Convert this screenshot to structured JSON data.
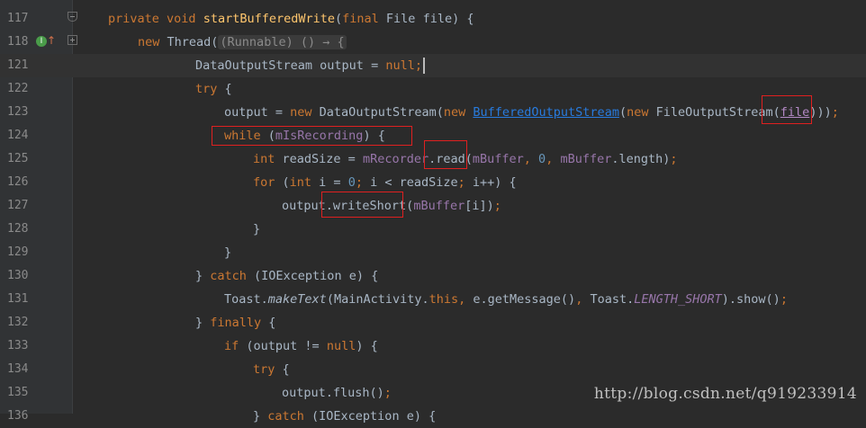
{
  "editor": {
    "current_line": 121,
    "lines": [
      {
        "number": "117",
        "tokens": [
          {
            "t": "private",
            "c": "kw"
          },
          {
            "t": " "
          },
          {
            "t": "void",
            "c": "kw"
          },
          {
            "t": " "
          },
          {
            "t": "startBufferedWrite",
            "c": "fn"
          },
          {
            "t": "("
          },
          {
            "t": "final",
            "c": "kw"
          },
          {
            "t": " File file) {"
          }
        ]
      },
      {
        "number": "118",
        "tokens": [
          {
            "t": "new",
            "c": "kw"
          },
          {
            "t": " Thread("
          },
          {
            "t": "(Runnable) () → {",
            "c": "hint"
          }
        ]
      },
      {
        "number": "121",
        "tokens": [
          {
            "t": "DataOutputStream output = "
          },
          {
            "t": "null",
            "c": "kw"
          },
          {
            "t": ";",
            "c": "kw"
          }
        ]
      },
      {
        "number": "122",
        "tokens": [
          {
            "t": "try",
            "c": "kw"
          },
          {
            "t": " {"
          }
        ]
      },
      {
        "number": "123",
        "tokens": [
          {
            "t": "output = "
          },
          {
            "t": "new",
            "c": "kw"
          },
          {
            "t": " DataOutputStream("
          },
          {
            "t": "new",
            "c": "kw"
          },
          {
            "t": " "
          },
          {
            "t": "BufferedOutputStream",
            "c": "link"
          },
          {
            "t": "("
          },
          {
            "t": "new",
            "c": "kw"
          },
          {
            "t": " FileOutputStream("
          },
          {
            "t": "file",
            "c": "paramu"
          },
          {
            "t": ")))"
          },
          {
            "t": ";",
            "c": "kw"
          }
        ]
      },
      {
        "number": "124",
        "tokens": [
          {
            "t": "while",
            "c": "kw"
          },
          {
            "t": " ("
          },
          {
            "t": "mIsRecording",
            "c": "fld"
          },
          {
            "t": ") {"
          }
        ]
      },
      {
        "number": "125",
        "tokens": [
          {
            "t": "int",
            "c": "kw"
          },
          {
            "t": " readSize = "
          },
          {
            "t": "mRecorder",
            "c": "fld"
          },
          {
            "t": ".read("
          },
          {
            "t": "mBuffer",
            "c": "fld"
          },
          {
            "t": ", ",
            "c": "kw"
          },
          {
            "t": "0",
            "c": "num"
          },
          {
            "t": ", ",
            "c": "kw"
          },
          {
            "t": "mBuffer",
            "c": "fld"
          },
          {
            "t": ".length)"
          },
          {
            "t": ";",
            "c": "kw"
          }
        ]
      },
      {
        "number": "126",
        "tokens": [
          {
            "t": "for",
            "c": "kw"
          },
          {
            "t": " ("
          },
          {
            "t": "int",
            "c": "kw"
          },
          {
            "t": " i = "
          },
          {
            "t": "0",
            "c": "num"
          },
          {
            "t": "; ",
            "c": "kw"
          },
          {
            "t": "i < readSize"
          },
          {
            "t": "; ",
            "c": "kw"
          },
          {
            "t": "i++) {"
          }
        ]
      },
      {
        "number": "127",
        "tokens": [
          {
            "t": "output.writeShort("
          },
          {
            "t": "mBuffer",
            "c": "fld"
          },
          {
            "t": "[i])"
          },
          {
            "t": ";",
            "c": "kw"
          }
        ]
      },
      {
        "number": "128",
        "tokens": [
          {
            "t": "}"
          }
        ]
      },
      {
        "number": "129",
        "tokens": [
          {
            "t": "}"
          }
        ]
      },
      {
        "number": "130",
        "tokens": [
          {
            "t": "} "
          },
          {
            "t": "catch",
            "c": "kw"
          },
          {
            "t": " (IOException e) {"
          }
        ]
      },
      {
        "number": "131",
        "tokens": [
          {
            "t": "Toast."
          },
          {
            "t": "makeText",
            "c": "it"
          },
          {
            "t": "(MainActivity."
          },
          {
            "t": "this",
            "c": "kw"
          },
          {
            "t": ", ",
            "c": "kw"
          },
          {
            "t": "e.getMessage()"
          },
          {
            "t": ", ",
            "c": "kw"
          },
          {
            "t": "Toast."
          },
          {
            "t": "LENGTH_SHORT",
            "c": "itfld"
          },
          {
            "t": ").show()"
          },
          {
            "t": ";",
            "c": "kw"
          }
        ]
      },
      {
        "number": "132",
        "tokens": [
          {
            "t": "} "
          },
          {
            "t": "finally",
            "c": "kw"
          },
          {
            "t": " {"
          }
        ]
      },
      {
        "number": "133",
        "tokens": [
          {
            "t": "if",
            "c": "kw"
          },
          {
            "t": " (output != "
          },
          {
            "t": "null",
            "c": "kw"
          },
          {
            "t": ") {"
          }
        ]
      },
      {
        "number": "134",
        "tokens": [
          {
            "t": "try",
            "c": "kw"
          },
          {
            "t": " {"
          }
        ]
      },
      {
        "number": "135",
        "tokens": [
          {
            "t": "output.flush()"
          },
          {
            "t": ";",
            "c": "kw"
          }
        ]
      },
      {
        "number": "136",
        "tokens": [
          {
            "t": "} "
          },
          {
            "t": "catch",
            "c": "kw"
          },
          {
            "t": " (IOException e) {"
          }
        ]
      }
    ]
  },
  "gutter": {
    "implements_icon": "I",
    "arrow_icon": "↑"
  },
  "watermark": "http://blog.csdn.net/q919233914",
  "colors": {
    "background": "#2b2b2b",
    "keyword": "#cc7832",
    "method": "#ffc66d",
    "field": "#9876aa",
    "number": "#6897bb",
    "text": "#a9b7c6",
    "highlight_box": "#e02020"
  }
}
